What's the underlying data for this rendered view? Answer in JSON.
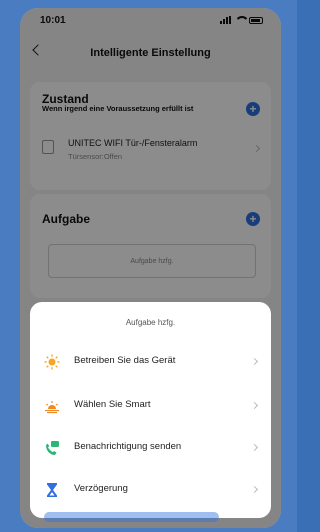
{
  "status_bar": {
    "time": "10:01"
  },
  "nav": {
    "title": "Intelligente Einstellung"
  },
  "condition": {
    "title": "Zustand",
    "subtitle": "Wenn irgend eine Voraussetzung erfüllt ist",
    "device_name": "UNITEC WIFI Tür-/Fensteralarm",
    "device_state": "Türsensor:Offen"
  },
  "task": {
    "title": "Aufgabe",
    "box_label": "Aufgabe hzfg."
  },
  "sheet": {
    "title": "Aufgabe hzfg.",
    "options": [
      {
        "label": "Betreiben Sie das Gerät",
        "icon": "sun-icon"
      },
      {
        "label": "Wählen Sie Smart",
        "icon": "sunrise-icon"
      },
      {
        "label": "Benachrichtigung senden",
        "icon": "phone-message-icon"
      },
      {
        "label": "Verzögerung",
        "icon": "hourglass-icon"
      }
    ]
  },
  "colors": {
    "accent": "#2f6fe0",
    "frame": "#4a7cc2"
  }
}
